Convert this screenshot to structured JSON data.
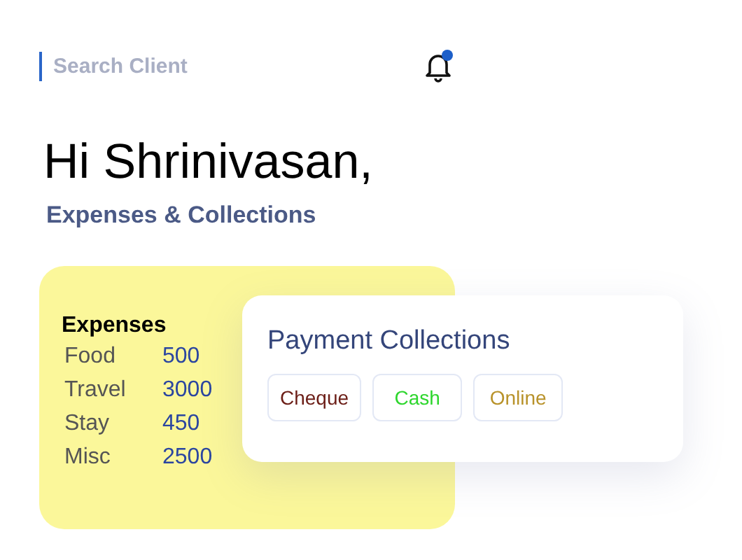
{
  "search": {
    "placeholder": "Search Client"
  },
  "notifications": {
    "unread": true
  },
  "greeting": "Hi Shrinivasan,",
  "subtitle": "Expenses & Collections",
  "expenses": {
    "title": "Expenses",
    "rows": [
      {
        "label": "Food",
        "amount": "500"
      },
      {
        "label": "Travel",
        "amount": "3000"
      },
      {
        "label": "Stay",
        "amount": "450"
      },
      {
        "label": "Misc",
        "amount": "2500"
      }
    ]
  },
  "payment_collections": {
    "title": "Payment Collections",
    "methods": [
      {
        "label": "Cheque",
        "color": "#6b1d16"
      },
      {
        "label": "Cash",
        "color": "#2ed62e"
      },
      {
        "label": "Online",
        "color": "#b8922a"
      }
    ]
  }
}
